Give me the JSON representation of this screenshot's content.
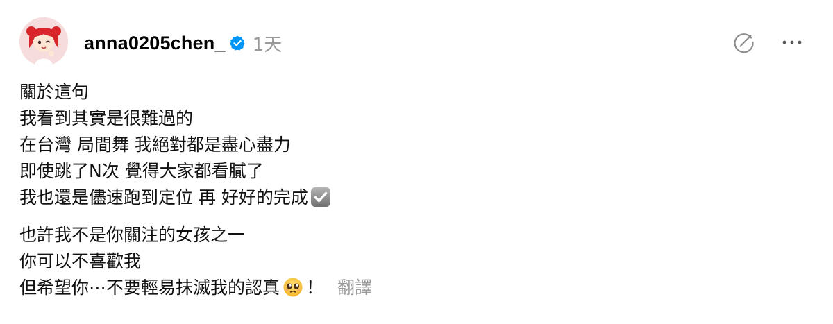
{
  "post": {
    "username": "anna0205chen_",
    "timestamp": "1天",
    "verified": true,
    "icons": {
      "avatar": "avatar-image",
      "verified": "verified-badge-icon",
      "edit": "edit-circle-icon",
      "more": "more-options-icon",
      "check": "check-box-emoji-icon",
      "pleading": "pleading-face-emoji-icon"
    },
    "colors": {
      "verified_blue": "#0095f6",
      "muted_gray": "#9a9a9a",
      "text": "#000000"
    },
    "paragraph1": [
      "關於這句",
      "我看到其實是很難過的",
      "在台灣 局間舞 我絕對都是盡心盡力",
      "即使跳了N次 覺得大家都看膩了",
      "我也還是儘速跑到定位 再 好好的完成"
    ],
    "paragraph2": [
      "也許我不是你關注的女孩之一",
      "你可以不喜歡我",
      "但希望你⋯不要輕易抹滅我的認真"
    ],
    "exclamation": "！",
    "translate_label": "翻譯"
  }
}
